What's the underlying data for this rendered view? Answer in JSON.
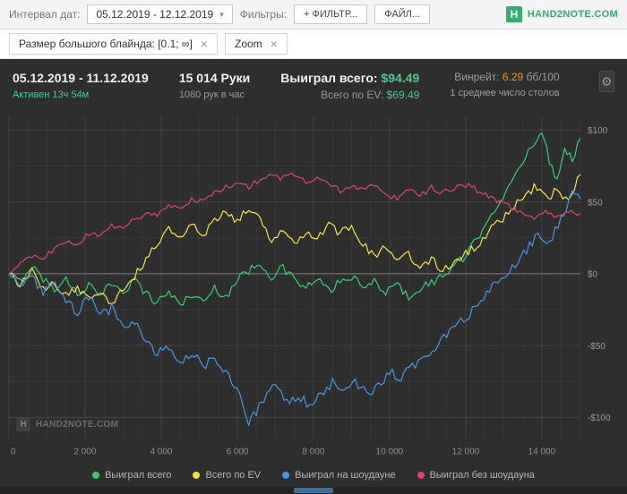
{
  "toolbar": {
    "date_label": "Интервал дат:",
    "date_range": "05.12.2019 - 12.12.2019",
    "filters_label": "Фильтры:",
    "filter_button": "+ ФИЛЬТР...",
    "file_button": "ФАЙЛ...",
    "brand": "HAND2NOTE.COM",
    "brand_letter": "H"
  },
  "chips": [
    {
      "label": "Размер большого блайнда: [0.1; ∞]"
    },
    {
      "label": "Zoom"
    }
  ],
  "stats": {
    "date_range": "05.12.2019 - 11.12.2019",
    "active": "Активен 13ч 54м",
    "hands": "15 014 Руки",
    "hands_per_hour": "1080 рук в час",
    "won_label": "Выиграл всего:",
    "won_value": "$94.49",
    "ev_label": "Всего по EV:",
    "ev_value": "$69.49",
    "winrate_label": "Винрейт:",
    "winrate_value": "6.29",
    "winrate_units": "бб/100",
    "avg_tables": "1 среднее число столов"
  },
  "watermark": {
    "brand": "HAND2NOTE.COM",
    "letter": "H"
  },
  "colors": {
    "accent_green": "#2fae6e",
    "value_green": "#3ecf8e",
    "winrate_orange": "#e8952f",
    "panel_bg": "#2e2e2e"
  },
  "chart_data": {
    "type": "line",
    "title": "",
    "xlabel": "",
    "ylabel": "",
    "x_range": [
      0,
      15014
    ],
    "y_range": [
      -115,
      110
    ],
    "x_ticks": [
      "0",
      "2 000",
      "4 000",
      "6 000",
      "8 000",
      "10 000",
      "12 000",
      "14 000"
    ],
    "x_tick_values": [
      0,
      2000,
      4000,
      6000,
      8000,
      10000,
      12000,
      14000
    ],
    "y_ticks": [
      "$100",
      "$50",
      "$0",
      "-$50",
      "-$100"
    ],
    "y_tick_values": [
      100,
      50,
      0,
      -50,
      -100
    ],
    "grid": true,
    "legend_position": "bottom",
    "series": [
      {
        "name": "Выиграл всего",
        "color": "#2fd072",
        "jitter": 6,
        "final_value": 94.49,
        "points": [
          [
            0,
            0
          ],
          [
            300,
            -6
          ],
          [
            600,
            6
          ],
          [
            900,
            -4
          ],
          [
            1200,
            -10
          ],
          [
            1500,
            -4
          ],
          [
            1800,
            -14
          ],
          [
            2100,
            -8
          ],
          [
            2400,
            -16
          ],
          [
            2700,
            -6
          ],
          [
            3000,
            -12
          ],
          [
            3300,
            -4
          ],
          [
            3600,
            -14
          ],
          [
            3900,
            -20
          ],
          [
            4200,
            -12
          ],
          [
            4500,
            -22
          ],
          [
            4800,
            -14
          ],
          [
            5100,
            -20
          ],
          [
            5400,
            -10
          ],
          [
            5700,
            -16
          ],
          [
            6000,
            -4
          ],
          [
            6300,
            2
          ],
          [
            6600,
            8
          ],
          [
            6900,
            -2
          ],
          [
            7200,
            4
          ],
          [
            7500,
            -4
          ],
          [
            7800,
            -10
          ],
          [
            8100,
            -4
          ],
          [
            8400,
            -12
          ],
          [
            8700,
            -6
          ],
          [
            9000,
            -2
          ],
          [
            9300,
            -10
          ],
          [
            9600,
            -6
          ],
          [
            9900,
            -12
          ],
          [
            10200,
            -8
          ],
          [
            10500,
            -16
          ],
          [
            10800,
            -10
          ],
          [
            11100,
            -6
          ],
          [
            11400,
            -2
          ],
          [
            11700,
            6
          ],
          [
            12000,
            12
          ],
          [
            12300,
            24
          ],
          [
            12600,
            40
          ],
          [
            12900,
            50
          ],
          [
            13200,
            62
          ],
          [
            13500,
            78
          ],
          [
            13800,
            92
          ],
          [
            14000,
            100
          ],
          [
            14200,
            78
          ],
          [
            14400,
            66
          ],
          [
            14600,
            88
          ],
          [
            14800,
            80
          ],
          [
            15014,
            94
          ]
        ]
      },
      {
        "name": "Всего по EV",
        "color": "#f2e33a",
        "jitter": 6,
        "final_value": 69.49,
        "points": [
          [
            0,
            0
          ],
          [
            300,
            -8
          ],
          [
            600,
            2
          ],
          [
            900,
            -12
          ],
          [
            1200,
            -6
          ],
          [
            1500,
            -16
          ],
          [
            1800,
            -10
          ],
          [
            2100,
            -18
          ],
          [
            2400,
            -12
          ],
          [
            2700,
            -20
          ],
          [
            3000,
            -10
          ],
          [
            3300,
            -2
          ],
          [
            3600,
            10
          ],
          [
            3900,
            22
          ],
          [
            4200,
            32
          ],
          [
            4500,
            24
          ],
          [
            4800,
            34
          ],
          [
            5100,
            26
          ],
          [
            5400,
            38
          ],
          [
            5700,
            44
          ],
          [
            6000,
            36
          ],
          [
            6300,
            46
          ],
          [
            6600,
            38
          ],
          [
            6900,
            24
          ],
          [
            7200,
            32
          ],
          [
            7500,
            22
          ],
          [
            7800,
            30
          ],
          [
            8100,
            24
          ],
          [
            8400,
            34
          ],
          [
            8700,
            28
          ],
          [
            9000,
            34
          ],
          [
            9300,
            20
          ],
          [
            9600,
            12
          ],
          [
            9900,
            18
          ],
          [
            10200,
            8
          ],
          [
            10500,
            14
          ],
          [
            10800,
            4
          ],
          [
            11100,
            10
          ],
          [
            11400,
            2
          ],
          [
            11700,
            8
          ],
          [
            12000,
            14
          ],
          [
            12300,
            20
          ],
          [
            12600,
            30
          ],
          [
            12900,
            36
          ],
          [
            13200,
            44
          ],
          [
            13500,
            54
          ],
          [
            13800,
            60
          ],
          [
            14100,
            52
          ],
          [
            14400,
            58
          ],
          [
            14700,
            50
          ],
          [
            15014,
            69
          ]
        ]
      },
      {
        "name": "Выиграл на шоудауне",
        "color": "#4596e8",
        "jitter": 7,
        "final_value": 52,
        "points": [
          [
            0,
            0
          ],
          [
            300,
            -8
          ],
          [
            600,
            -2
          ],
          [
            900,
            -14
          ],
          [
            1200,
            -8
          ],
          [
            1500,
            -20
          ],
          [
            1800,
            -26
          ],
          [
            2100,
            -16
          ],
          [
            2400,
            -30
          ],
          [
            2700,
            -24
          ],
          [
            3000,
            -38
          ],
          [
            3300,
            -32
          ],
          [
            3600,
            -48
          ],
          [
            3900,
            -56
          ],
          [
            4200,
            -50
          ],
          [
            4500,
            -62
          ],
          [
            4800,
            -54
          ],
          [
            5100,
            -66
          ],
          [
            5400,
            -58
          ],
          [
            5700,
            -70
          ],
          [
            6000,
            -78
          ],
          [
            6300,
            -104
          ],
          [
            6500,
            -96
          ],
          [
            6700,
            -88
          ],
          [
            7000,
            -78
          ],
          [
            7300,
            -90
          ],
          [
            7600,
            -84
          ],
          [
            7900,
            -92
          ],
          [
            8200,
            -84
          ],
          [
            8500,
            -76
          ],
          [
            8800,
            -82
          ],
          [
            9100,
            -76
          ],
          [
            9400,
            -84
          ],
          [
            9700,
            -78
          ],
          [
            10000,
            -68
          ],
          [
            10300,
            -74
          ],
          [
            10600,
            -64
          ],
          [
            10900,
            -58
          ],
          [
            11200,
            -50
          ],
          [
            11500,
            -44
          ],
          [
            11800,
            -36
          ],
          [
            12100,
            -28
          ],
          [
            12400,
            -20
          ],
          [
            12700,
            -10
          ],
          [
            13000,
            -2
          ],
          [
            13300,
            6
          ],
          [
            13600,
            16
          ],
          [
            13900,
            28
          ],
          [
            14200,
            22
          ],
          [
            14500,
            38
          ],
          [
            14800,
            56
          ],
          [
            15014,
            52
          ]
        ]
      },
      {
        "name": "Выиграл без шоудауна",
        "color": "#de4370",
        "jitter": 4,
        "final_value": 42,
        "points": [
          [
            0,
            0
          ],
          [
            300,
            6
          ],
          [
            600,
            12
          ],
          [
            900,
            10
          ],
          [
            1200,
            18
          ],
          [
            1500,
            22
          ],
          [
            1800,
            20
          ],
          [
            2100,
            28
          ],
          [
            2400,
            26
          ],
          [
            2700,
            34
          ],
          [
            3000,
            32
          ],
          [
            3300,
            38
          ],
          [
            3600,
            42
          ],
          [
            3900,
            40
          ],
          [
            4200,
            48
          ],
          [
            4500,
            46
          ],
          [
            4800,
            52
          ],
          [
            5100,
            50
          ],
          [
            5400,
            56
          ],
          [
            5700,
            60
          ],
          [
            6000,
            64
          ],
          [
            6300,
            60
          ],
          [
            6600,
            66
          ],
          [
            6900,
            70
          ],
          [
            7200,
            66
          ],
          [
            7500,
            70
          ],
          [
            7800,
            64
          ],
          [
            8100,
            68
          ],
          [
            8400,
            62
          ],
          [
            8700,
            58
          ],
          [
            9000,
            62
          ],
          [
            9300,
            58
          ],
          [
            9600,
            62
          ],
          [
            9900,
            56
          ],
          [
            10200,
            52
          ],
          [
            10500,
            58
          ],
          [
            10800,
            54
          ],
          [
            11100,
            60
          ],
          [
            11400,
            56
          ],
          [
            11700,
            60
          ],
          [
            12000,
            62
          ],
          [
            12300,
            58
          ],
          [
            12600,
            54
          ],
          [
            12900,
            50
          ],
          [
            13200,
            46
          ],
          [
            13500,
            42
          ],
          [
            13800,
            38
          ],
          [
            14100,
            44
          ],
          [
            14400,
            40
          ],
          [
            14700,
            44
          ],
          [
            15014,
            42
          ]
        ]
      }
    ]
  }
}
